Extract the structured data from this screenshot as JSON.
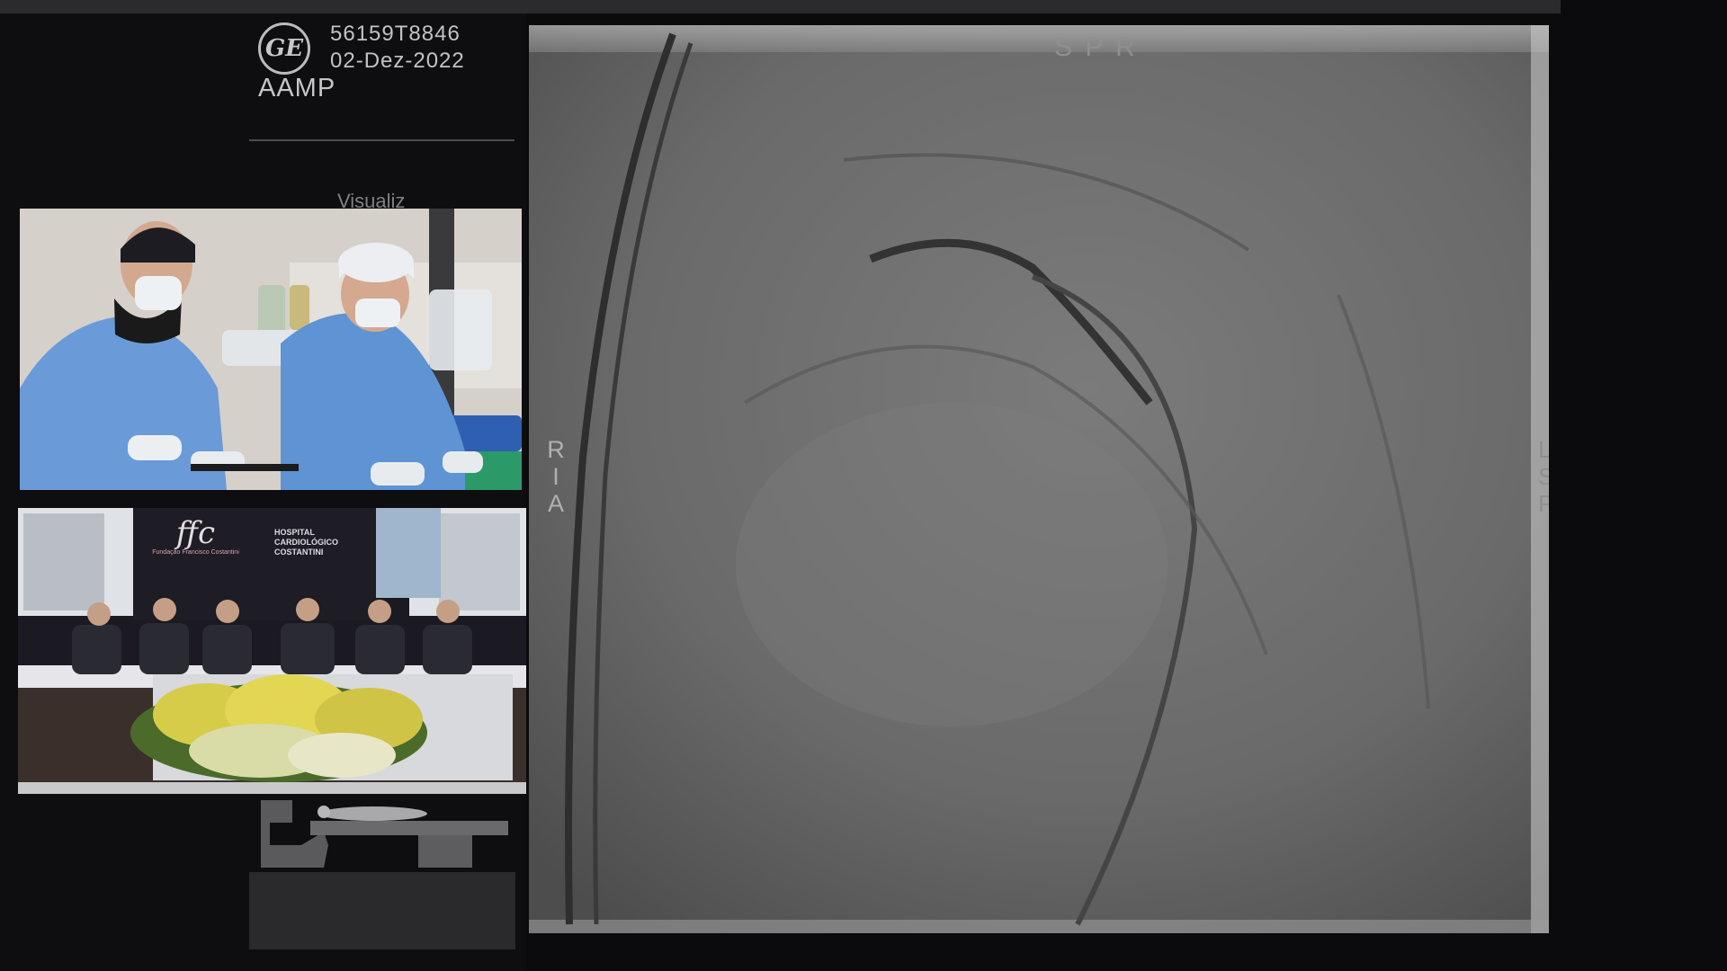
{
  "header": {
    "logo_text": "GE",
    "patient_id": "56159T8846",
    "date": "02-Dez-2022",
    "site": "AAMP",
    "view_label": "Visualiz"
  },
  "xray": {
    "orientation_top": "S P R",
    "orientation_left": [
      "R",
      "I",
      "A"
    ],
    "orientation_right": [
      "L",
      "S",
      "P"
    ]
  },
  "panel_feed": {
    "logo_text": "ffc",
    "org_caption": "Fundação Francisco Costantini",
    "hospital_line1": "HOSPITAL",
    "hospital_line2": "CARDIOLÓGICO",
    "hospital_line3": "COSTANTINI"
  },
  "colors": {
    "background": "#0b0a0c",
    "scrubs": "#6a9bd8",
    "xray_mid": "#6e6e6e"
  },
  "icons": [
    "ge-logo-icon",
    "patient-table-icon"
  ]
}
